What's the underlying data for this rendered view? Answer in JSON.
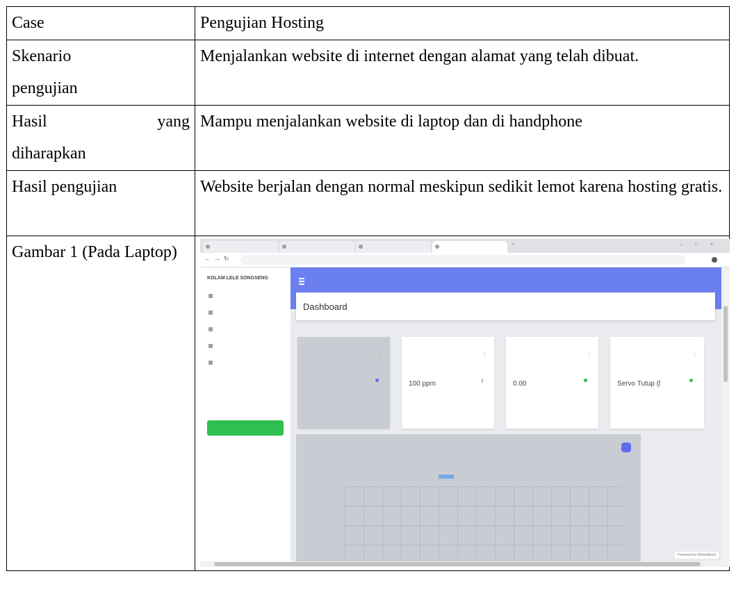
{
  "table": {
    "rows": [
      {
        "label": "Case",
        "value": "Pengujian Hosting"
      },
      {
        "label_line1": "Skenario",
        "label_line2": "pengujian",
        "value": "Menjalankan website di internet dengan alamat yang telah dibuat."
      },
      {
        "label_a": "Hasil",
        "label_b": "yang",
        "label_line2": "diharapkan",
        "value": "Mampu menjalankan website di laptop dan di handphone"
      },
      {
        "label": "Hasil pengujian",
        "value": "Website berjalan dengan normal meskipun sedikit lemot karena hosting gratis."
      },
      {
        "label": "Gambar 1 (Pada Laptop)"
      }
    ]
  },
  "screenshot": {
    "page_title": "Dashboard",
    "sidebar_brand": "KOLAM LELE SONGSENG",
    "cards": [
      {
        "value": "100 ppm"
      },
      {
        "value": "0.00"
      },
      {
        "value": "Servo Tutup (l"
      }
    ],
    "badge": "Powered by 000webhost",
    "accent": "#6a7ff0",
    "button_color": "#2fbe50"
  }
}
